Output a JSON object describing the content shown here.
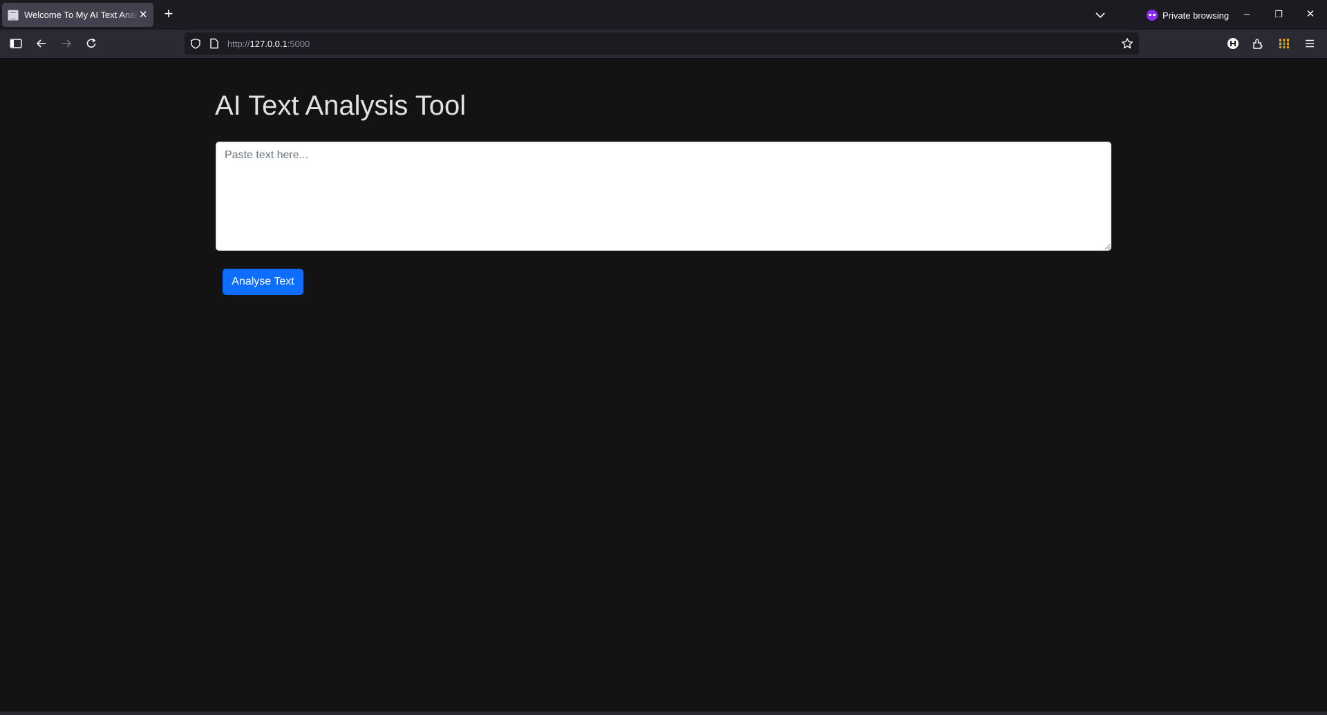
{
  "browser": {
    "tab": {
      "title": "Welcome To My AI Text Analysis",
      "close_glyph": "✕"
    },
    "new_tab_glyph": "+",
    "private_label": "Private browsing",
    "url": {
      "scheme": "http://",
      "host": "127.0.0.1",
      "port": ":5000"
    },
    "icons": [
      "sidebar-icon",
      "back-icon",
      "forward-icon",
      "reload-icon",
      "shield-icon",
      "page-icon",
      "bookmark-star-icon",
      "extension-h-icon",
      "extensions-icon",
      "grid-extension-icon",
      "menu-icon"
    ],
    "window_controls": {
      "minimize": "–",
      "restore": "❐",
      "close": "✕"
    }
  },
  "page": {
    "title": "AI Text Analysis Tool",
    "textarea": {
      "placeholder": "Paste text here...",
      "value": ""
    },
    "analyse_button": "Analyse Text"
  },
  "colors": {
    "page_background": "#131313",
    "button_primary": "#0d6efd",
    "private_accent": "#8c2cf5"
  }
}
